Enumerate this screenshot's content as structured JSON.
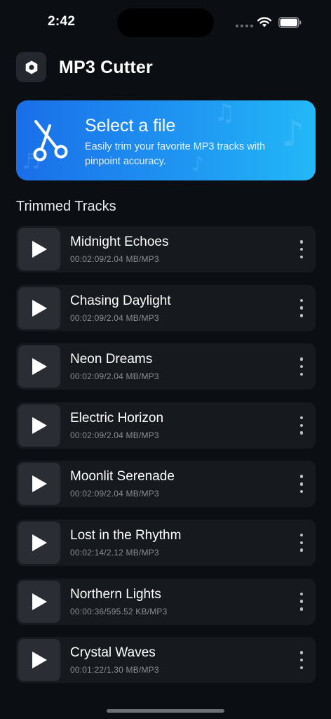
{
  "status_bar": {
    "time": "2:42"
  },
  "header": {
    "title": "MP3 Cutter",
    "icon": "hexagon-nut-icon"
  },
  "banner": {
    "title": "Select a file",
    "subtitle": "Easily trim your favorite MP3 tracks with pinpoint accuracy.",
    "icon": "scissors-icon",
    "colors": {
      "start": "#1a6ee8",
      "end": "#23b8f7"
    }
  },
  "section": {
    "title": "Trimmed Tracks"
  },
  "tracks": [
    {
      "name": "Midnight Echoes",
      "meta": "00:02:09/2.04 MB/MP3"
    },
    {
      "name": "Chasing Daylight",
      "meta": "00:02:09/2.04 MB/MP3"
    },
    {
      "name": "Neon Dreams",
      "meta": "00:02:09/2.04 MB/MP3"
    },
    {
      "name": "Electric Horizon",
      "meta": "00:02:09/2.04 MB/MP3"
    },
    {
      "name": "Moonlit Serenade",
      "meta": "00:02:09/2.04 MB/MP3"
    },
    {
      "name": "Lost in the Rhythm",
      "meta": "00:02:14/2.12 MB/MP3"
    },
    {
      "name": "Northern Lights",
      "meta": "00:00:36/595.52 KB/MP3"
    },
    {
      "name": "Crystal Waves",
      "meta": "00:01:22/1.30 MB/MP3"
    }
  ]
}
